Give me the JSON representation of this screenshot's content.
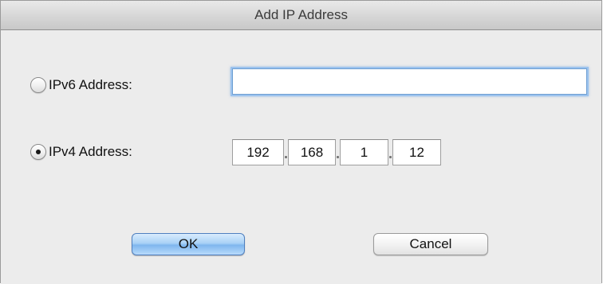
{
  "dialog": {
    "title": "Add IP Address"
  },
  "ipv6": {
    "label": "IPv6 Address:",
    "selected": false,
    "value": ""
  },
  "ipv4": {
    "label": "IPv4 Address:",
    "selected": true,
    "octets": [
      "192",
      "168",
      "1",
      "12"
    ]
  },
  "buttons": {
    "ok_label": "OK",
    "cancel_label": "Cancel"
  },
  "colors": {
    "focus_ring": "#9cc3ee",
    "default_button": "#a9d1f6",
    "window_bg": "#ececec"
  }
}
